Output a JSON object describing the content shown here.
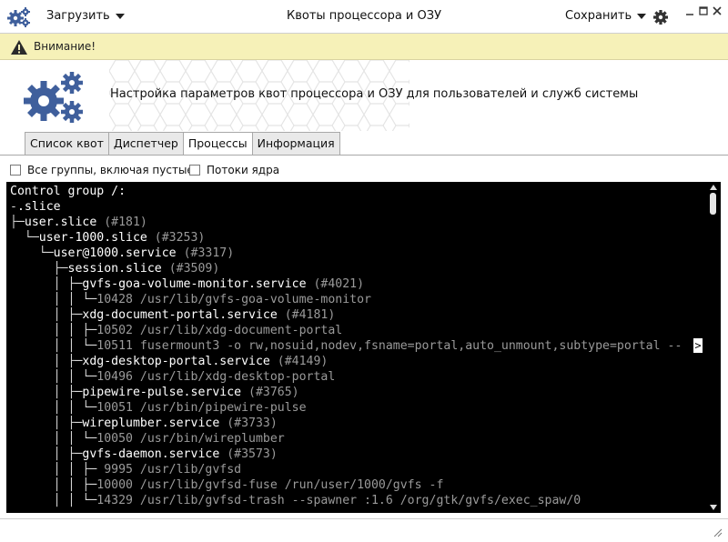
{
  "window": {
    "title": "Квоты процессора и ОЗУ",
    "load_label": "Загрузить",
    "save_label": "Сохранить"
  },
  "warning": {
    "text": "Внимание!"
  },
  "banner": {
    "text": "Настройка параметров квот процессора и ОЗУ для пользователей и служб системы"
  },
  "tabs": [
    {
      "label": "Список квот",
      "active": false
    },
    {
      "label": "Диспетчер",
      "active": false
    },
    {
      "label": "Процессы",
      "active": true
    },
    {
      "label": "Информация",
      "active": false
    }
  ],
  "options": {
    "all_groups": {
      "label": "Все группы, включая пустые",
      "checked": false
    },
    "kernel_threads": {
      "label": "Потоки ядра",
      "checked": false
    }
  },
  "terminal": {
    "more_marker": ">",
    "lines": [
      {
        "prefix": "",
        "name": "Control group /:",
        "meta": ""
      },
      {
        "prefix": "-",
        "name": ".slice",
        "meta": ""
      },
      {
        "prefix": "├─",
        "name": "user.slice",
        "meta": " (#181)"
      },
      {
        "prefix": "  └─",
        "name": "user-1000.slice",
        "meta": " (#3253)"
      },
      {
        "prefix": "    └─",
        "name": "user@1000.service",
        "meta": " (#3317)"
      },
      {
        "prefix": "      ├─",
        "name": "session.slice",
        "meta": " (#3509)"
      },
      {
        "prefix": "      │ ├─",
        "name": "gvfs-goa-volume-monitor.service",
        "meta": " (#4021)"
      },
      {
        "prefix": "      │ │ └─",
        "name": "",
        "meta": "10428 /usr/lib/gvfs-goa-volume-monitor"
      },
      {
        "prefix": "      │ ├─",
        "name": "xdg-document-portal.service",
        "meta": " (#4181)"
      },
      {
        "prefix": "      │ │ ├─",
        "name": "",
        "meta": "10502 /usr/lib/xdg-document-portal"
      },
      {
        "prefix": "      │ │ └─",
        "name": "",
        "meta": "10511 fusermount3 -o rw,nosuid,nodev,fsname=portal,auto_unmount,subtype=portal --"
      },
      {
        "prefix": "      │ ├─",
        "name": "xdg-desktop-portal.service",
        "meta": " (#4149)"
      },
      {
        "prefix": "      │ │ └─",
        "name": "",
        "meta": "10496 /usr/lib/xdg-desktop-portal"
      },
      {
        "prefix": "      │ ├─",
        "name": "pipewire-pulse.service",
        "meta": " (#3765)"
      },
      {
        "prefix": "      │ │ └─",
        "name": "",
        "meta": "10051 /usr/bin/pipewire-pulse"
      },
      {
        "prefix": "      │ ├─",
        "name": "wireplumber.service",
        "meta": " (#3733)"
      },
      {
        "prefix": "      │ │ └─",
        "name": "",
        "meta": "10050 /usr/bin/wireplumber"
      },
      {
        "prefix": "      │ ├─",
        "name": "gvfs-daemon.service",
        "meta": " (#3573)"
      },
      {
        "prefix": "      │ │ ├─",
        "name": "",
        "meta": " 9995 /usr/lib/gvfsd"
      },
      {
        "prefix": "      │ │ ├─",
        "name": "",
        "meta": "10000 /usr/lib/gvfsd-fuse /run/user/1000/gvfs -f"
      },
      {
        "prefix": "      │ │ └─",
        "name": "",
        "meta": "14329 /usr/lib/gvfsd-trash --spawner :1.6 /org/gtk/gvfs/exec_spaw/0"
      }
    ]
  },
  "icons": {
    "app": "gear-cluster-icon",
    "settings": "gear-icon",
    "warning": "warning-triangle-icon",
    "banner": "gear-cluster-icon"
  },
  "colors": {
    "accent_gear": "#3f5f9c",
    "warning_bg": "#f6f1b8",
    "terminal_bg": "#000000"
  }
}
